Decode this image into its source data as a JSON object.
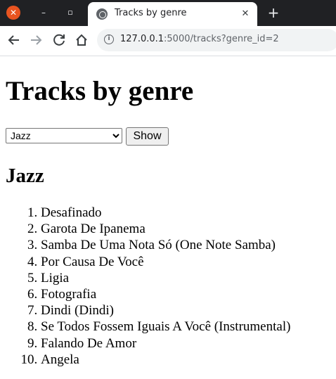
{
  "browser": {
    "tab_title": "Tracks by genre",
    "url_host": "127.0.0.1",
    "url_rest": ":5000/tracks?genre_id=2",
    "window_close_glyph": "✕",
    "window_minimize_glyph": "–",
    "window_maximize_glyph": "▫",
    "tab_close_glyph": "✕",
    "new_tab_glyph": "+",
    "icons": [
      "close-icon",
      "minimize-icon",
      "maximize-icon",
      "globe-icon",
      "plus-icon",
      "back-icon",
      "forward-icon",
      "reload-icon",
      "home-icon",
      "info-icon"
    ]
  },
  "page": {
    "heading": "Tracks by genre",
    "genre_select": {
      "selected": "Jazz"
    },
    "show_button": "Show",
    "genre_heading": "Jazz",
    "tracks": [
      "Desafinado",
      "Garota De Ipanema",
      "Samba De Uma Nota Só (One Note Samba)",
      "Por Causa De Você",
      "Ligia",
      "Fotografia",
      "Dindi (Dindi)",
      "Se Todos Fossem Iguais A Você (Instrumental)",
      "Falando De Amor",
      "Angela"
    ]
  }
}
